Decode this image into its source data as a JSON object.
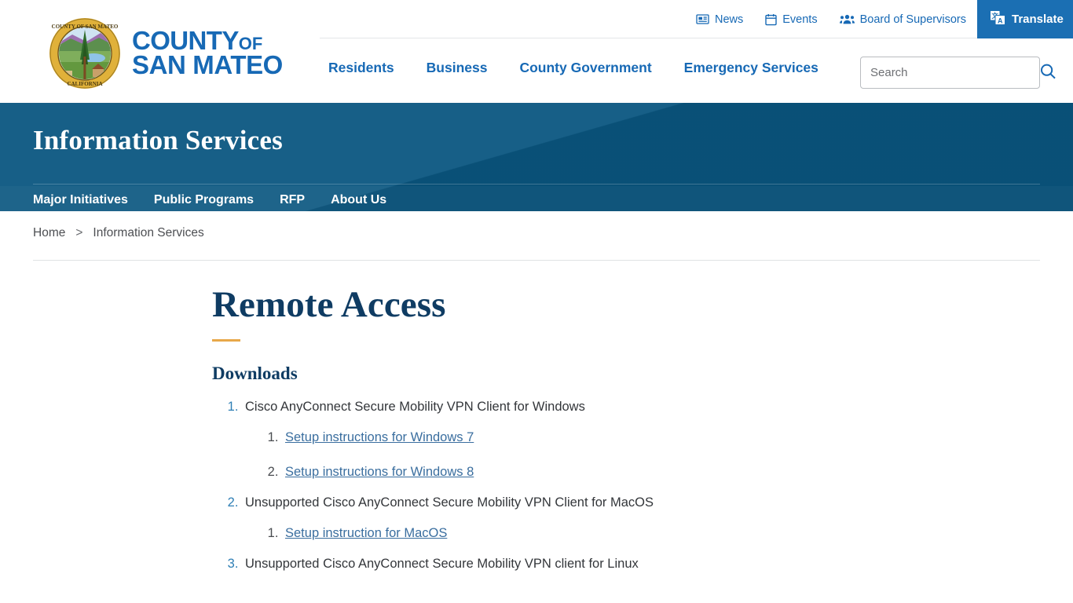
{
  "header": {
    "logo": {
      "seal_alt": "county-seal",
      "seal_text_top": "COUNTY OF SAN MATEO",
      "seal_text_bottom": "CALIFORNIA",
      "wordmark_line1": "COUNTY",
      "wordmark_line1_small": "OF",
      "wordmark_line2": "SAN MATEO"
    },
    "utility": [
      {
        "label": "News",
        "icon": "newspaper-icon"
      },
      {
        "label": "Events",
        "icon": "calendar-icon"
      },
      {
        "label": "Board of Supervisors",
        "icon": "people-icon"
      }
    ],
    "translate": {
      "label": "Translate",
      "icon": "translate-icon"
    },
    "nav": [
      {
        "label": "Residents"
      },
      {
        "label": "Business"
      },
      {
        "label": "County Government"
      },
      {
        "label": "Emergency Services"
      }
    ],
    "search": {
      "placeholder": "Search",
      "value": "",
      "icon": "search-icon"
    }
  },
  "banner": {
    "title": "Information Services",
    "subnav": [
      {
        "label": "Major Initiatives"
      },
      {
        "label": "Public Programs"
      },
      {
        "label": "RFP"
      },
      {
        "label": "About Us"
      }
    ]
  },
  "breadcrumb": {
    "home": "Home",
    "separator": ">",
    "current": "Information Services"
  },
  "main": {
    "title": "Remote Access",
    "section_heading": "Downloads",
    "items": [
      {
        "text": "Cisco AnyConnect Secure Mobility VPN Client for Windows",
        "links": [
          {
            "label": "Setup instructions for Windows 7"
          },
          {
            "label": "Setup instructions for Windows 8"
          }
        ]
      },
      {
        "text": "Unsupported Cisco AnyConnect Secure Mobility VPN Client for MacOS",
        "links": [
          {
            "label": "Setup instruction for MacOS"
          }
        ]
      },
      {
        "text": "Unsupported Cisco AnyConnect Secure Mobility VPN client for Linux",
        "links": []
      }
    ]
  },
  "colors": {
    "brand_blue": "#1769b5",
    "banner_teal": "#0a5680",
    "heading_navy": "#0f3c63",
    "accent_orange": "#e8a849",
    "link_blue": "#3a6e9f",
    "translate_blue": "#1b6fb3"
  }
}
